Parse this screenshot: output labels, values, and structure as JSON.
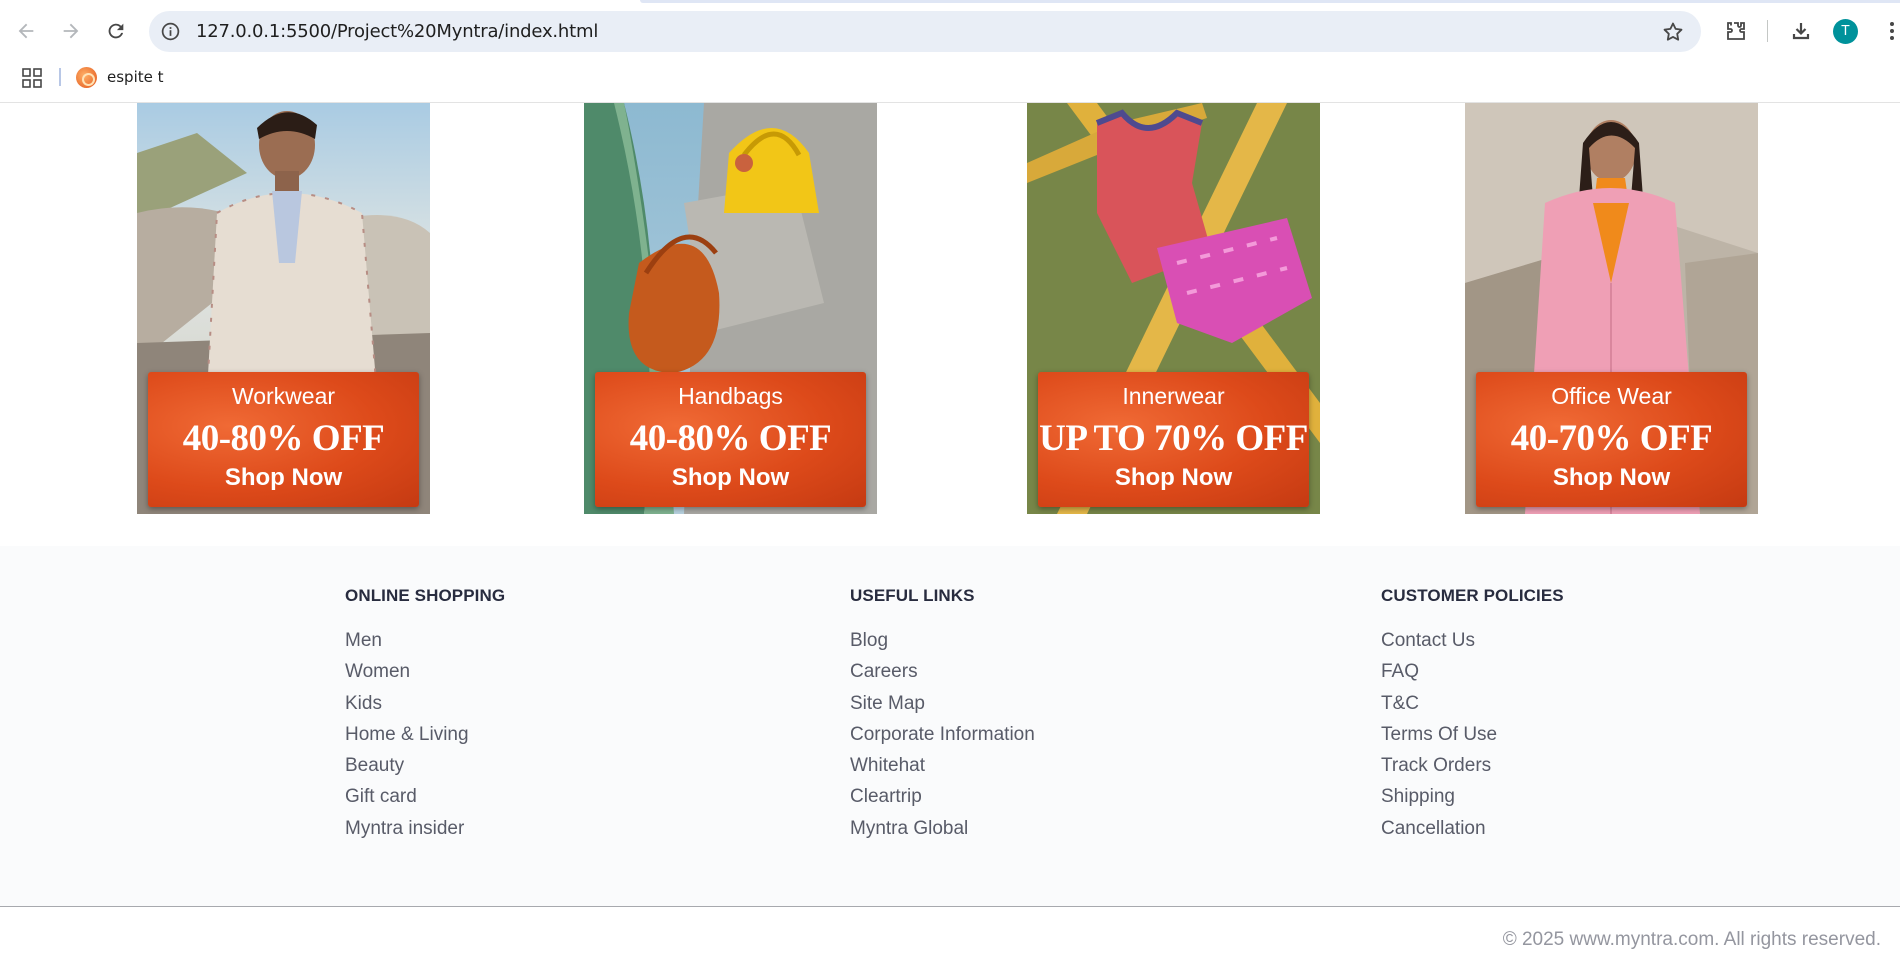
{
  "browser": {
    "url": "127.0.0.1:5500/Project%20Myntra/index.html",
    "profile_initial": "T",
    "bookmarks": [
      {
        "label": "espite t",
        "icon": "favicon-icon"
      }
    ]
  },
  "banners": [
    {
      "category": "Workwear",
      "offer": "40-80% OFF",
      "cta": "Shop Now"
    },
    {
      "category": "Handbags",
      "offer": "40-80% OFF",
      "cta": "Shop Now"
    },
    {
      "category": "Innerwear",
      "offer": "UP TO 70% OFF",
      "cta": "Shop Now"
    },
    {
      "category": "Office Wear",
      "offer": "40-70% OFF",
      "cta": "Shop Now"
    }
  ],
  "footer": {
    "online_shopping": {
      "title": "ONLINE SHOPPING",
      "links": [
        "Men",
        "Women",
        "Kids",
        "Home & Living",
        "Beauty",
        "Gift card",
        "Myntra insider"
      ]
    },
    "useful_links": {
      "title": "USEFUL LINKS",
      "links": [
        "Blog",
        "Careers",
        "Site Map",
        "Corporate Information",
        "Whitehat",
        "Cleartrip",
        "Myntra Global"
      ]
    },
    "customer_policies": {
      "title": "CUSTOMER POLICIES",
      "links": [
        "Contact Us",
        "FAQ",
        "T&C",
        "Terms Of Use",
        "Track Orders",
        "Shipping",
        "Cancellation"
      ]
    },
    "copyright": "© 2025 www.myntra.com. All rights reserved."
  },
  "colors": {
    "tag_orange": "#dd4a1a",
    "footer_bg": "#fafbfc",
    "heading": "#282c3f",
    "link": "#585b68",
    "avatar": "#00929b"
  }
}
